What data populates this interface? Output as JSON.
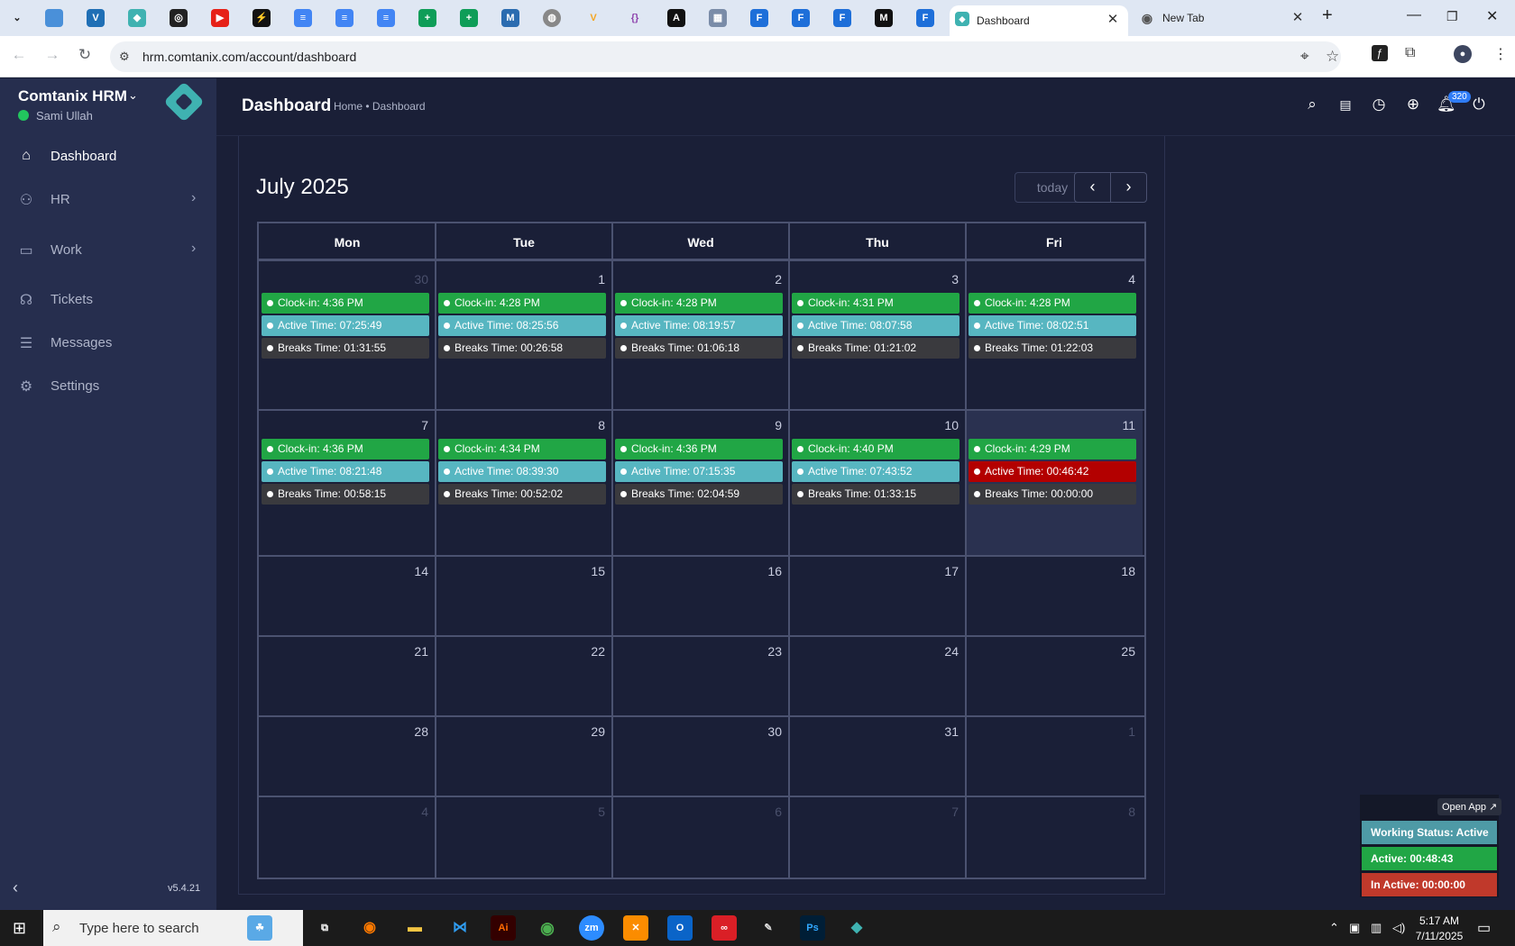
{
  "browser": {
    "tabs": [
      {
        "label": "Dashboard",
        "active": true
      },
      {
        "label": "New Tab",
        "active": false
      }
    ],
    "url": "hrm.comtanix.com/account/dashboard"
  },
  "sidebar": {
    "app_name": "Comtanix HRM",
    "user_name": "Sami Ullah",
    "items": [
      {
        "label": "Dashboard",
        "icon": "home-icon",
        "active": true
      },
      {
        "label": "HR",
        "icon": "users-icon",
        "has_submenu": true
      },
      {
        "label": "Work",
        "icon": "briefcase-icon",
        "has_submenu": true
      },
      {
        "label": "Tickets",
        "icon": "headset-icon"
      },
      {
        "label": "Messages",
        "icon": "message-icon"
      },
      {
        "label": "Settings",
        "icon": "gear-icon"
      }
    ],
    "version": "v5.4.21"
  },
  "header": {
    "title": "Dashboard",
    "breadcrumb": "Home • Dashboard",
    "notification_count": "320"
  },
  "calendar": {
    "title": "July 2025",
    "today_label": "today",
    "prev_label": "‹",
    "next_label": "›",
    "weekdays": [
      "Mon",
      "Tue",
      "Wed",
      "Thu",
      "Fri"
    ],
    "weeks": [
      [
        {
          "day": "30",
          "other": true,
          "events": [
            [
              "green",
              "Clock-in: 4:36 PM"
            ],
            [
              "teal",
              "Active Time: 07:25:49"
            ],
            [
              "dark",
              "Breaks Time: 01:31:55"
            ]
          ]
        },
        {
          "day": "1",
          "events": [
            [
              "green",
              "Clock-in: 4:28 PM"
            ],
            [
              "teal",
              "Active Time: 08:25:56"
            ],
            [
              "dark",
              "Breaks Time: 00:26:58"
            ]
          ]
        },
        {
          "day": "2",
          "events": [
            [
              "green",
              "Clock-in: 4:28 PM"
            ],
            [
              "teal",
              "Active Time: 08:19:57"
            ],
            [
              "dark",
              "Breaks Time: 01:06:18"
            ]
          ]
        },
        {
          "day": "3",
          "events": [
            [
              "green",
              "Clock-in: 4:31 PM"
            ],
            [
              "teal",
              "Active Time: 08:07:58"
            ],
            [
              "dark",
              "Breaks Time: 01:21:02"
            ]
          ]
        },
        {
          "day": "4",
          "events": [
            [
              "green",
              "Clock-in: 4:28 PM"
            ],
            [
              "teal",
              "Active Time: 08:02:51"
            ],
            [
              "dark",
              "Breaks Time: 01:22:03"
            ]
          ]
        }
      ],
      [
        {
          "day": "7",
          "events": [
            [
              "green",
              "Clock-in: 4:36 PM"
            ],
            [
              "teal",
              "Active Time: 08:21:48"
            ],
            [
              "dark",
              "Breaks Time: 00:58:15"
            ]
          ]
        },
        {
          "day": "8",
          "events": [
            [
              "green",
              "Clock-in: 4:34 PM"
            ],
            [
              "teal",
              "Active Time: 08:39:30"
            ],
            [
              "dark",
              "Breaks Time: 00:52:02"
            ]
          ]
        },
        {
          "day": "9",
          "events": [
            [
              "green",
              "Clock-in: 4:36 PM"
            ],
            [
              "teal",
              "Active Time: 07:15:35"
            ],
            [
              "dark",
              "Breaks Time: 02:04:59"
            ]
          ]
        },
        {
          "day": "10",
          "events": [
            [
              "green",
              "Clock-in: 4:40 PM"
            ],
            [
              "teal",
              "Active Time: 07:43:52"
            ],
            [
              "dark",
              "Breaks Time: 01:33:15"
            ]
          ]
        },
        {
          "day": "11",
          "today": true,
          "events": [
            [
              "green",
              "Clock-in: 4:29 PM"
            ],
            [
              "red",
              "Active Time: 00:46:42"
            ],
            [
              "dark",
              "Breaks Time: 00:00:00"
            ]
          ]
        }
      ],
      [
        {
          "day": "14"
        },
        {
          "day": "15"
        },
        {
          "day": "16"
        },
        {
          "day": "17"
        },
        {
          "day": "18"
        }
      ],
      [
        {
          "day": "21"
        },
        {
          "day": "22"
        },
        {
          "day": "23"
        },
        {
          "day": "24"
        },
        {
          "day": "25"
        }
      ],
      [
        {
          "day": "28"
        },
        {
          "day": "29"
        },
        {
          "day": "30"
        },
        {
          "day": "31"
        },
        {
          "day": "1",
          "other": true
        }
      ],
      [
        {
          "day": "4",
          "other": true
        },
        {
          "day": "5",
          "other": true
        },
        {
          "day": "6",
          "other": true
        },
        {
          "day": "7",
          "other": true
        },
        {
          "day": "8",
          "other": true
        }
      ]
    ],
    "colors": {
      "green": "#21a645",
      "teal": "#57b6c1",
      "dark": "#3a3a3e",
      "red": "#b30000"
    }
  },
  "status_widget": {
    "open_app": "Open App ↗",
    "working_status": "Working Status: Active",
    "active": "Active: 00:48:43",
    "inactive": "In Active: 00:00:00"
  },
  "taskbar": {
    "search_placeholder": "Type here to search",
    "time": "5:17 AM",
    "date": "7/11/2025"
  }
}
